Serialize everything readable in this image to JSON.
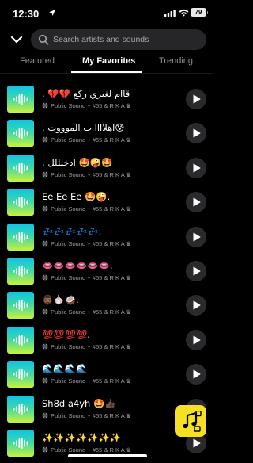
{
  "status_bar": {
    "time": "12:30",
    "battery": "79"
  },
  "search": {
    "placeholder": "Search artists and sounds"
  },
  "tabs": [
    {
      "label": "Featured",
      "active": false
    },
    {
      "label": "My Favorites",
      "active": true
    },
    {
      "label": "Trending",
      "active": false
    }
  ],
  "sounds": [
    {
      "title": "",
      "type": "Public Sound",
      "author": "#55 & R K A ♛"
    },
    {
      "title": ". 💔💔 قاام لغيري ركع",
      "type": "Public Sound",
      "author": "#55 & R K A ♛"
    },
    {
      "title": ". اهلاااا ب الموووت😰",
      "type": "Public Sound",
      "author": "#55 & R K A ♛"
    },
    {
      "title": ". ادخلللل 🤩🤪🤩",
      "type": "Public Sound",
      "author": "#55 & R K A ♛"
    },
    {
      "title": "Ee   Ee  Ee 🤩🤪.",
      "type": "Public Sound",
      "author": "#55 & R K A ♛"
    },
    {
      "title": "💤💤💤💤💤.",
      "type": "Public Sound",
      "author": "#55 & R K A ♛"
    },
    {
      "title": "👄👄👄👄👄👄.",
      "type": "Public Sound",
      "author": "#55 & R K A ♛"
    },
    {
      "title": "🧔🏾‍♂️🧄🥥.",
      "type": "Public Sound",
      "author": "#55 & R K A ♛"
    },
    {
      "title": "💯💯💯💯.",
      "type": "Public Sound",
      "author": "#55 & R K A ♛"
    },
    {
      "title": "🌊🌊🌊🌊",
      "type": "Public Sound",
      "author": "#55 & R K A ♛"
    },
    {
      "title": "Sh8d a4yh 🤩👍🏿",
      "type": "Public Sound",
      "author": "#55 & R K A ♛"
    },
    {
      "title": "✨✨✨✨✨✨✨",
      "type": "Public Sound",
      "author": "#55 & R K A ♛"
    }
  ],
  "icons": {
    "back": "chevron-down-icon",
    "search": "search-icon",
    "thumb": "waveform-icon",
    "play": "play-icon",
    "globe": "globe-icon",
    "fab": "music-note-icon"
  },
  "colors": {
    "background": "#000000",
    "thumb_gradient": [
      "#0fc3e6",
      "#3ed8a6",
      "#c9f23a"
    ],
    "fab": "#f6df25",
    "tab_inactive": "#8c8c90"
  }
}
